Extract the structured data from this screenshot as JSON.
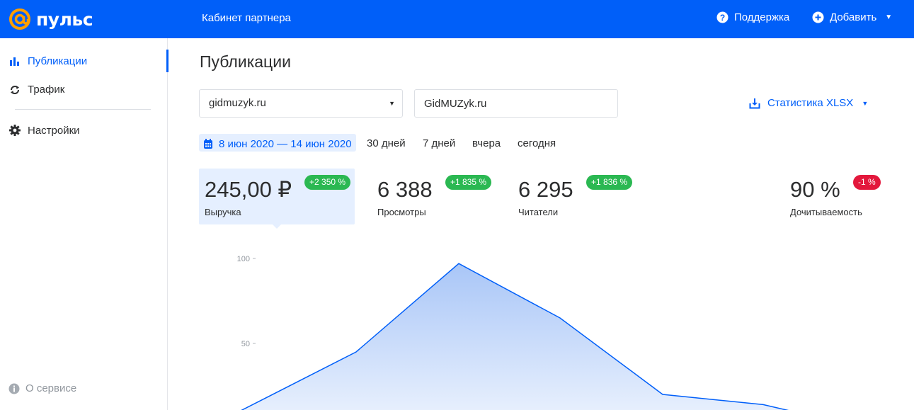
{
  "header": {
    "logo_text": "пульс",
    "title": "Кабинет партнера",
    "support_label": "Поддержка",
    "add_label": "Добавить",
    "brand_color": "#005ff9"
  },
  "sidebar": {
    "items": [
      {
        "label": "Публикации",
        "icon": "bar-chart-icon",
        "active": true
      },
      {
        "label": "Трафик",
        "icon": "refresh-icon",
        "active": false
      },
      {
        "label": "Настройки",
        "icon": "gear-icon",
        "active": false
      }
    ],
    "about_label": "О сервисе"
  },
  "main": {
    "title": "Публикации",
    "site_select": {
      "value": "gidmuzyk.ru"
    },
    "name_field": {
      "value": "GidMUZyk.ru"
    },
    "export_label": "Статистика XLSX",
    "date_range": "8 июн 2020 — 14 июн 2020",
    "periods": [
      "30 дней",
      "7 дней",
      "вчера",
      "сегодня"
    ]
  },
  "metrics": [
    {
      "value": "245,00 ₽",
      "label": "Выручка",
      "change": "+2 350 %",
      "trend": "up",
      "selected": true
    },
    {
      "value": "6 388",
      "label": "Просмотры",
      "change": "+1 835 %",
      "trend": "up",
      "selected": false
    },
    {
      "value": "6 295",
      "label": "Читатели",
      "change": "+1 836 %",
      "trend": "up",
      "selected": false
    },
    {
      "value": "90 %",
      "label": "Дочитываемость",
      "change": "-1 %",
      "trend": "down",
      "selected": false
    }
  ],
  "chart_data": {
    "type": "area",
    "y_ticks": [
      "100",
      "50"
    ],
    "ylim": [
      0,
      100
    ],
    "series": [
      {
        "values": [
          10,
          45,
          97,
          65,
          20,
          14,
          0
        ]
      }
    ],
    "color": "#005ff9"
  }
}
